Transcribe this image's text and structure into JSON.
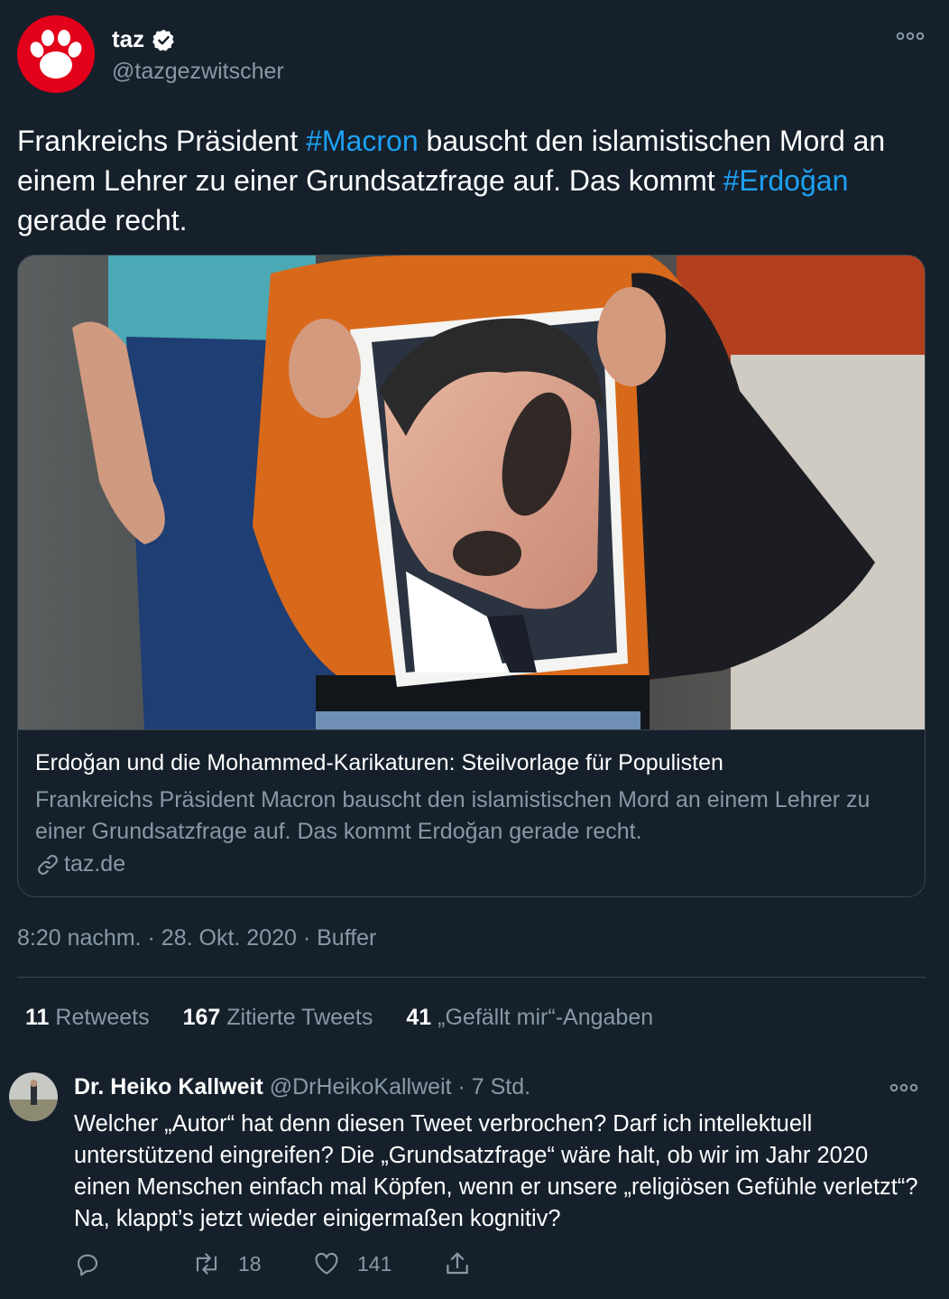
{
  "tweet": {
    "author_name": "taz",
    "handle": "@tazgezwitscher",
    "text_parts": [
      "Frankreichs Präsident ",
      "#Macron",
      " bauscht den islamistischen Mord an einem Lehrer zu einer Grundsatzfrage auf. Das kommt ",
      "#Erdoğan",
      " gerade recht."
    ],
    "card": {
      "title": "Erdoğan und die Mohammed-Karikaturen: Steilvorlage für Populisten",
      "description": "Frankreichs Präsident Macron bauscht den islamistischen Mord an einem Lehrer zu einer Grundsatzfrage auf. Das kommt Erdoğan gerade recht.",
      "domain": "taz.de"
    },
    "meta": "8:20 nachm. · 28. Okt. 2020 · Buffer",
    "stats": {
      "retweets_count": "11",
      "retweets_label": "Retweets",
      "quotes_count": "167",
      "quotes_label": "Zitierte Tweets",
      "likes_count": "41",
      "likes_label": "„Gefällt mir“-Angaben"
    }
  },
  "reply": {
    "name": "Dr. Heiko Kallweit",
    "meta": "@DrHeikoKallweit · 7 Std.",
    "text": "Welcher „Autor“ hat denn diesen Tweet verbrochen? Darf ich intellektuell unterstützend eingreifen? Die „Grundsatzfrage“ wäre halt, ob wir im Jahr 2020 einen Menschen einfach mal Köpfen, wenn er unsere „religiösen Gefühle verletzt“? Na, klappt’s jetzt wieder einigermaßen kognitiv?",
    "retweets": "18",
    "likes": "141"
  },
  "icons": {
    "avatar": "taz-paw-logo",
    "verified": "verified-badge-icon",
    "more": "more-options-icon",
    "link": "link-icon",
    "reply": "reply-icon",
    "retweet": "retweet-icon",
    "like": "heart-icon",
    "share": "share-icon"
  },
  "colors": {
    "background": "#15202b",
    "secondary_text": "#8899a6",
    "hashtag": "#1da1f2",
    "border": "#38444d",
    "brand_red": "#e2001a"
  }
}
